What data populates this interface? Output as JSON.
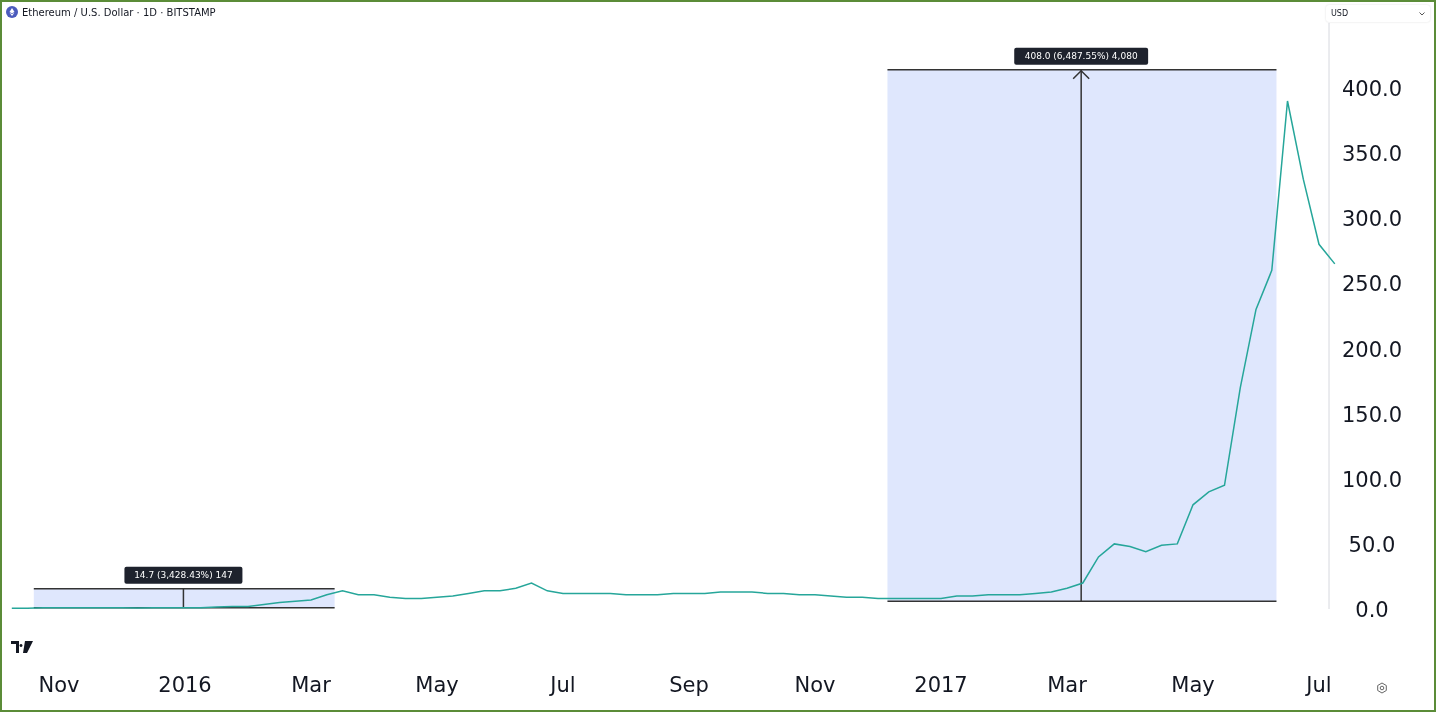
{
  "header": {
    "title": "Ethereum / U.S. Dollar · 1D · BITSTAMP"
  },
  "currency_select": {
    "value": "USD"
  },
  "chart_data": {
    "type": "line",
    "ylim": [
      0,
      450
    ],
    "yticks": [
      {
        "value": 0,
        "label": "0.0"
      },
      {
        "value": 50,
        "label": "50.0"
      },
      {
        "value": 100,
        "label": "100.0"
      },
      {
        "value": 150,
        "label": "150.0"
      },
      {
        "value": 200,
        "label": "200.0"
      },
      {
        "value": 250,
        "label": "250.0"
      },
      {
        "value": 300,
        "label": "300.0"
      },
      {
        "value": 350,
        "label": "350.0"
      },
      {
        "value": 400,
        "label": "400.0"
      }
    ],
    "categories": [
      null,
      null,
      null,
      "Nov",
      null,
      null,
      null,
      null,
      null,
      null,
      null,
      "2016",
      null,
      null,
      null,
      null,
      null,
      null,
      null,
      "Mar",
      null,
      null,
      null,
      null,
      null,
      null,
      null,
      "May",
      null,
      null,
      null,
      null,
      null,
      null,
      null,
      "Jul",
      null,
      null,
      null,
      null,
      null,
      null,
      null,
      "Sep",
      null,
      null,
      null,
      null,
      null,
      null,
      null,
      "Nov",
      null,
      null,
      null,
      null,
      null,
      null,
      null,
      "2017",
      null,
      null,
      null,
      null,
      null,
      null,
      null,
      "Mar",
      null,
      null,
      null,
      null,
      null,
      null,
      null,
      "May",
      null,
      null,
      null,
      null,
      null,
      null,
      null,
      "Jul",
      null
    ],
    "series": [
      {
        "color": "#26a69a",
        "values": [
          0.6,
          0.5,
          1,
          1,
          0.9,
          0.9,
          0.9,
          0.9,
          0.8,
          0.9,
          0.9,
          1,
          1,
          1.5,
          2,
          2,
          3.5,
          5,
          6,
          7,
          11,
          14,
          11,
          11,
          9,
          8,
          8,
          9,
          10,
          12,
          14,
          14,
          16,
          20,
          14,
          12,
          12,
          12,
          12,
          11,
          11,
          11,
          12,
          12,
          12,
          13,
          13,
          13,
          12,
          12,
          11,
          11,
          10,
          9,
          9,
          8,
          8,
          8,
          8,
          8,
          10,
          10,
          11,
          11,
          11,
          12,
          13,
          16,
          20,
          40,
          50,
          48,
          44,
          49,
          50,
          80,
          90,
          95,
          170,
          230,
          260,
          390,
          330,
          280,
          265
        ]
      }
    ]
  },
  "measurements": [
    {
      "arrow": false,
      "label": "14.7 (3,428.43%) 147"
    },
    {
      "arrow": true,
      "label": "408.0 (6,487.55%) 4,080"
    }
  ]
}
